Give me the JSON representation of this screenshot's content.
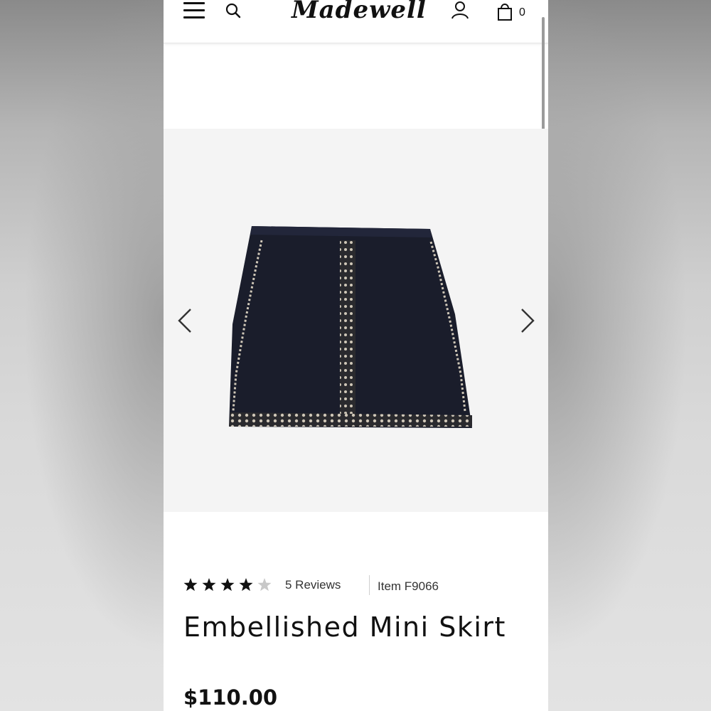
{
  "header": {
    "logo_text": "Madewell",
    "bag_count": "0",
    "icons": [
      "menu-icon",
      "search-icon",
      "account-icon",
      "shopping-bag-icon"
    ]
  },
  "gallery": {
    "prev_icon": "chevron-left-icon",
    "next_icon": "chevron-right-icon",
    "image_subject": "navy mini skirt with embroidered trim"
  },
  "product": {
    "rating": 4,
    "rating_max": 5,
    "reviews_label": "5 Reviews",
    "item_label": "Item F9066",
    "title": "Embellished Mini Skirt",
    "price": "$110.00"
  },
  "colors": {
    "text": "#111111",
    "star_filled": "#111111",
    "star_empty": "#c8c8c8",
    "gallery_bg": "#f4f4f4",
    "skirt": "#1a1d2b"
  }
}
